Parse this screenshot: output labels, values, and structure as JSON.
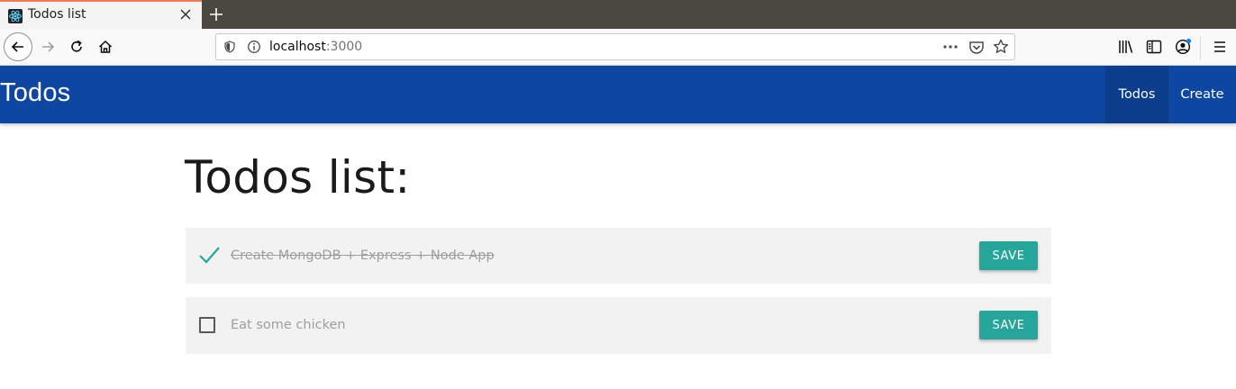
{
  "browser": {
    "tab_title": "Todos list",
    "url_host": "localhost",
    "url_port": ":3000"
  },
  "app": {
    "brand": "Todos",
    "nav": {
      "todos": "Todos",
      "create": "Create"
    },
    "accent": "#0d47a1",
    "button_color": "#26a69a"
  },
  "main": {
    "title": "Todos list:",
    "todos": [
      {
        "text": "Create MongoDB + Express + Node App",
        "completed": true,
        "save_label": "SAVE"
      },
      {
        "text": "Eat some chicken",
        "completed": false,
        "save_label": "SAVE"
      }
    ]
  }
}
